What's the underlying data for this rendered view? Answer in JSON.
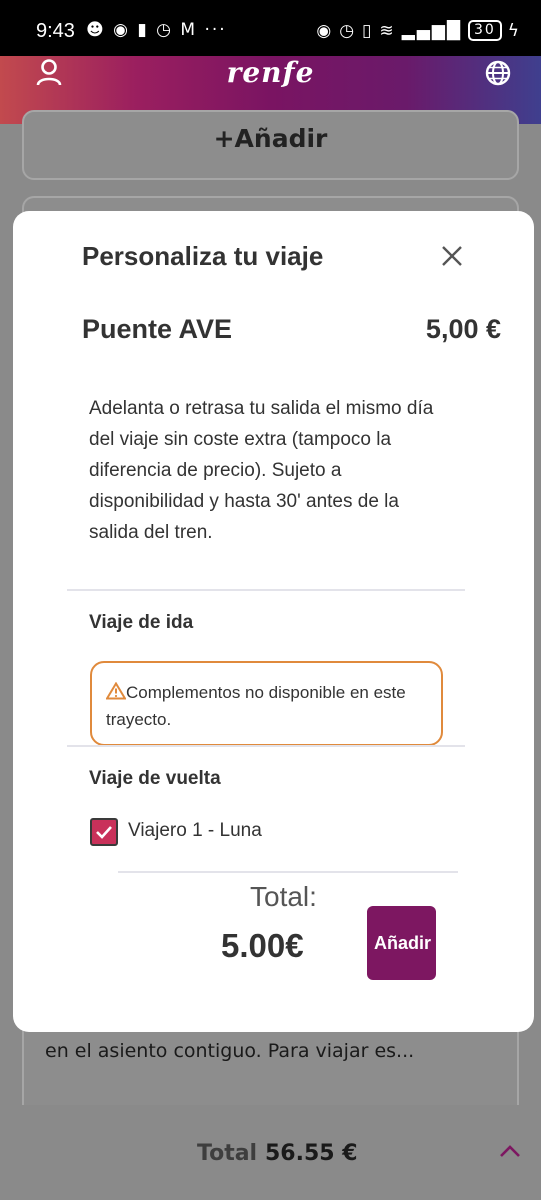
{
  "status_bar": {
    "time": "9:43",
    "battery": "30",
    "left_icons": [
      "notification-icon",
      "wechat-icon",
      "battery-saver-icon",
      "alarm-icon",
      "gmail-icon",
      "more-dots-icon"
    ],
    "right_icons": [
      "eye-icon",
      "alarm-icon",
      "vibrate-icon",
      "wifi-6-icon",
      "signal-icon",
      "battery-icon",
      "charging-icon"
    ]
  },
  "header": {
    "logo": "renfe",
    "colors": {
      "start": "#c24a4e",
      "mid": "#7a1462",
      "end": "#3f3f8e"
    }
  },
  "background": {
    "add_label": "+Añadir",
    "seat_text": "en el asiento contiguo. Para viajar es...",
    "total_label": "Total",
    "total_value": "56.55 €"
  },
  "modal": {
    "title": "Personaliza tu viaje",
    "product_name": "Puente AVE",
    "product_price": "5,00 €",
    "description": "Adelanta o retrasa tu salida el mismo día del viaje sin coste extra (tampoco la diferencia de precio). Sujeto a disponibilidad y hasta 30' antes de la salida del tren.",
    "outbound_title": "Viaje de ida",
    "warning": "Complementos no disponible en este trayecto.",
    "return_title": "Viaje de vuelta",
    "traveler": {
      "label": "Viajero 1 - Luna",
      "checked": true
    },
    "total_label": "Total:",
    "total_value": "5.00€",
    "add_button": "Añadir",
    "colors": {
      "accent": "#7d1761",
      "checkbox": "#c9315a",
      "warning_border": "#e08a3c"
    }
  }
}
